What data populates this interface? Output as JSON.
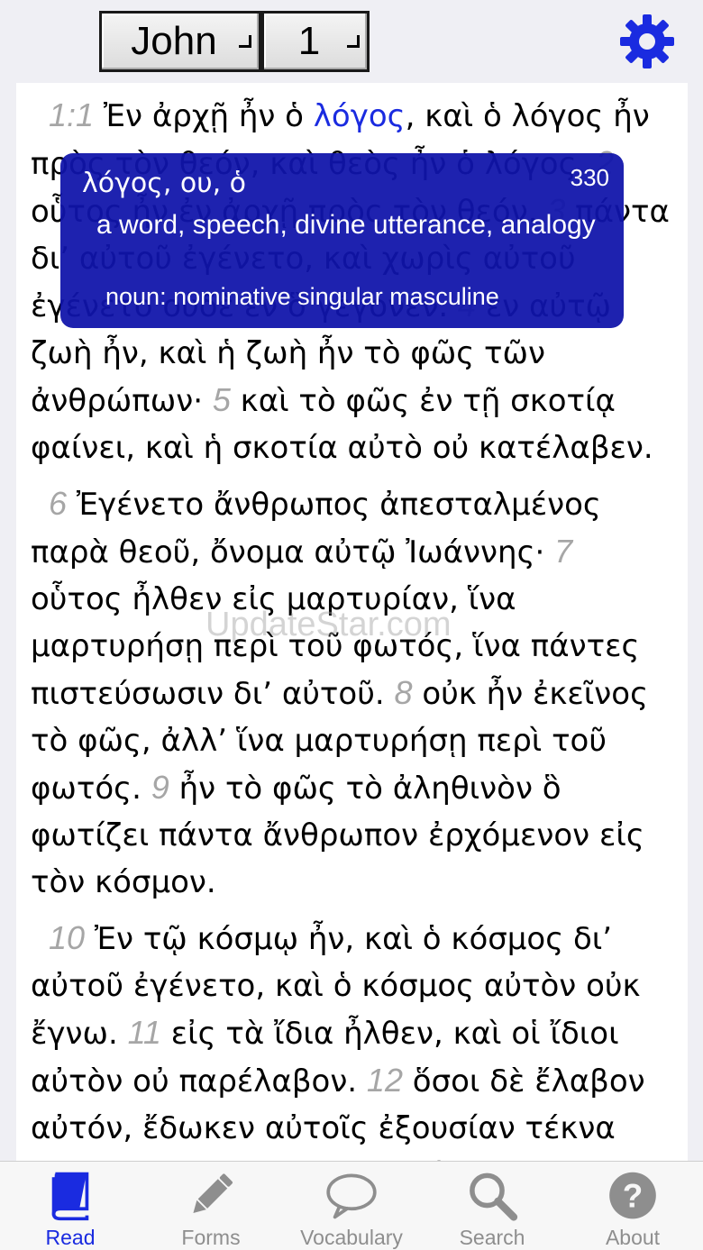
{
  "header": {
    "book": "John",
    "chapter": "1",
    "settings_icon": "gear-icon",
    "accent_color": "#1a2be0"
  },
  "text": {
    "paragraphs": [
      {
        "segments": [
          {
            "v": "1:1"
          },
          {
            "t": " Ἐν ἀρχῇ ἦν ὁ "
          },
          {
            "h": "λόγος"
          },
          {
            "t": ", καὶ ὁ λόγος ἦν πρὸς τὸν θεόν, καὶ θεὸς ἦν ὁ λόγος. "
          },
          {
            "v": "2"
          },
          {
            "t": " οὗτος ἦν ἐν ἀρχῇ πρὸς τὸν θεόν. "
          },
          {
            "v": "3"
          },
          {
            "t": " πάντα δι’ αὐτοῦ ἐγένετο, καὶ χωρὶς αὐτοῦ ἐγένετο οὐδὲ ἕν ὃ γέγονεν. "
          },
          {
            "v": "4"
          },
          {
            "t": " ἐν αὐτῷ ζωὴ ἦν, καὶ ἡ ζωὴ ἦν τὸ φῶς τῶν ἀνθρώπων· "
          },
          {
            "v": "5"
          },
          {
            "t": " καὶ τὸ φῶς ἐν τῇ σκοτίᾳ φαίνει, καὶ ἡ σκοτία αὐτὸ οὐ κατέλαβεν."
          }
        ]
      },
      {
        "segments": [
          {
            "v": "6"
          },
          {
            "t": " Ἐγένετο ἄνθρωπος ἀπεσταλμένος παρὰ θεοῦ, ὄνομα αὐτῷ Ἰωάννης· "
          },
          {
            "v": "7"
          },
          {
            "t": " οὗτος ἦλθεν εἰς μαρτυρίαν, ἵνα μαρτυρήσῃ περὶ τοῦ φωτός, ἵνα πάντες πιστεύσωσιν δι’ αὐτοῦ. "
          },
          {
            "v": "8"
          },
          {
            "t": " οὐκ ἦν ἐκεῖνος τὸ φῶς, ἀλλ’ ἵνα μαρτυρήσῃ περὶ τοῦ φωτός. "
          },
          {
            "v": "9"
          },
          {
            "t": " ἦν τὸ φῶς τὸ ἀληθινὸν ὃ φωτίζει πάντα ἄνθρωπον ἐρχόμενον εἰς τὸν κόσμον."
          }
        ]
      },
      {
        "segments": [
          {
            "v": "10"
          },
          {
            "t": " Ἐν τῷ κόσμῳ ἦν, καὶ ὁ κόσμος δι’ αὐτοῦ ἐγένετο, καὶ ὁ κόσμος αὐτὸν οὐκ ἔγνω. "
          },
          {
            "v": "11"
          },
          {
            "t": " εἰς τὰ ἴδια ἦλθεν, καὶ οἱ ἴδιοι αὐτὸν οὐ παρέλαβον. "
          },
          {
            "v": "12"
          },
          {
            "t": " ὅσοι δὲ ἔλαβον αὐτόν, ἔδωκεν αὐτοῖς ἐξουσίαν τέκνα θεοῦ γενέσθαι, τοῖς πιστεύουσιν"
          }
        ]
      }
    ]
  },
  "popup": {
    "lemma": "λόγος, ου, ὁ",
    "count": "330",
    "gloss": "a word, speech, divine utterance, analogy",
    "parse": "noun: nominative singular masculine",
    "background": "#1014aa"
  },
  "watermark": "UpdateStar.com",
  "tabs": [
    {
      "label": "Read",
      "icon": "book-icon",
      "active": true
    },
    {
      "label": "Forms",
      "icon": "pencil-icon",
      "active": false
    },
    {
      "label": "Vocabulary",
      "icon": "speech-bubble-icon",
      "active": false
    },
    {
      "label": "Search",
      "icon": "search-icon",
      "active": false
    },
    {
      "label": "About",
      "icon": "question-icon",
      "active": false
    }
  ]
}
